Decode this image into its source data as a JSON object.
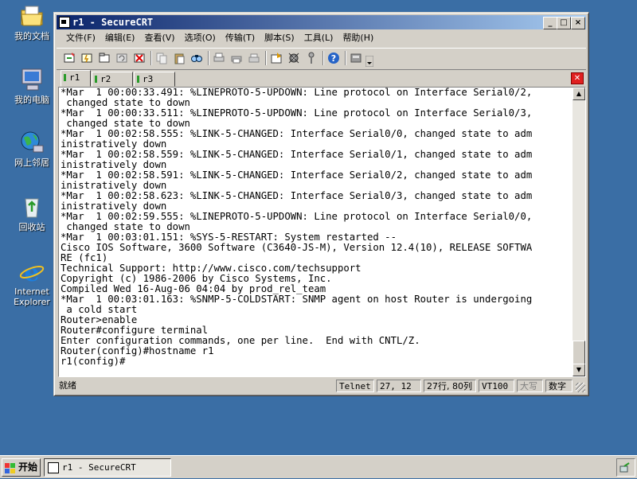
{
  "desktop": {
    "icons": [
      {
        "label": "我的文档",
        "icon": "my-documents-icon"
      },
      {
        "label": "我的电脑",
        "icon": "my-computer-icon"
      },
      {
        "label": "网上邻居",
        "icon": "network-places-icon"
      },
      {
        "label": "回收站",
        "icon": "recycle-bin-icon"
      },
      {
        "label": "Internet\nExplorer",
        "icon": "internet-explorer-icon"
      }
    ]
  },
  "window": {
    "title": "r1 - SecureCRT",
    "controls": {
      "minimize": "_",
      "maximize": "□",
      "close": "×"
    }
  },
  "menu": [
    "文件(F)",
    "编辑(E)",
    "查看(V)",
    "选项(O)",
    "传输(T)",
    "脚本(S)",
    "工具(L)",
    "帮助(H)"
  ],
  "tabs": [
    {
      "label": "r1",
      "active": true
    },
    {
      "label": "r2",
      "active": false
    },
    {
      "label": "r3",
      "active": false
    }
  ],
  "terminal": {
    "lines": [
      "*Mar  1 00:00:33.491: %LINEPROTO-5-UPDOWN: Line protocol on Interface Serial0/2,",
      " changed state to down",
      "*Mar  1 00:00:33.511: %LINEPROTO-5-UPDOWN: Line protocol on Interface Serial0/3,",
      " changed state to down",
      "*Mar  1 00:02:58.555: %LINK-5-CHANGED: Interface Serial0/0, changed state to adm",
      "inistratively down",
      "*Mar  1 00:02:58.559: %LINK-5-CHANGED: Interface Serial0/1, changed state to adm",
      "inistratively down",
      "*Mar  1 00:02:58.591: %LINK-5-CHANGED: Interface Serial0/2, changed state to adm",
      "inistratively down",
      "*Mar  1 00:02:58.623: %LINK-5-CHANGED: Interface Serial0/3, changed state to adm",
      "inistratively down",
      "*Mar  1 00:02:59.555: %LINEPROTO-5-UPDOWN: Line protocol on Interface Serial0/0,",
      " changed state to down",
      "*Mar  1 00:03:01.151: %SYS-5-RESTART: System restarted --",
      "Cisco IOS Software, 3600 Software (C3640-JS-M), Version 12.4(10), RELEASE SOFTWA",
      "RE (fc1)",
      "Technical Support: http://www.cisco.com/techsupport",
      "Copyright (c) 1986-2006 by Cisco Systems, Inc.",
      "Compiled Wed 16-Aug-06 04:04 by prod_rel_team",
      "*Mar  1 00:03:01.163: %SNMP-5-COLDSTART: SNMP agent on host Router is undergoing",
      " a cold start",
      "Router>enable",
      "Router#configure terminal",
      "Enter configuration commands, one per line.  End with CNTL/Z.",
      "Router(config)#hostname r1",
      "r1(config)#"
    ]
  },
  "status": {
    "ready": "就绪",
    "protocol": "Telnet",
    "position": "27,  12",
    "size": "27行, 80列",
    "emulation": "VT100",
    "caps": "大写",
    "num": "数字"
  },
  "taskbar": {
    "start": "开始",
    "task": "r1 - SecureCRT"
  }
}
